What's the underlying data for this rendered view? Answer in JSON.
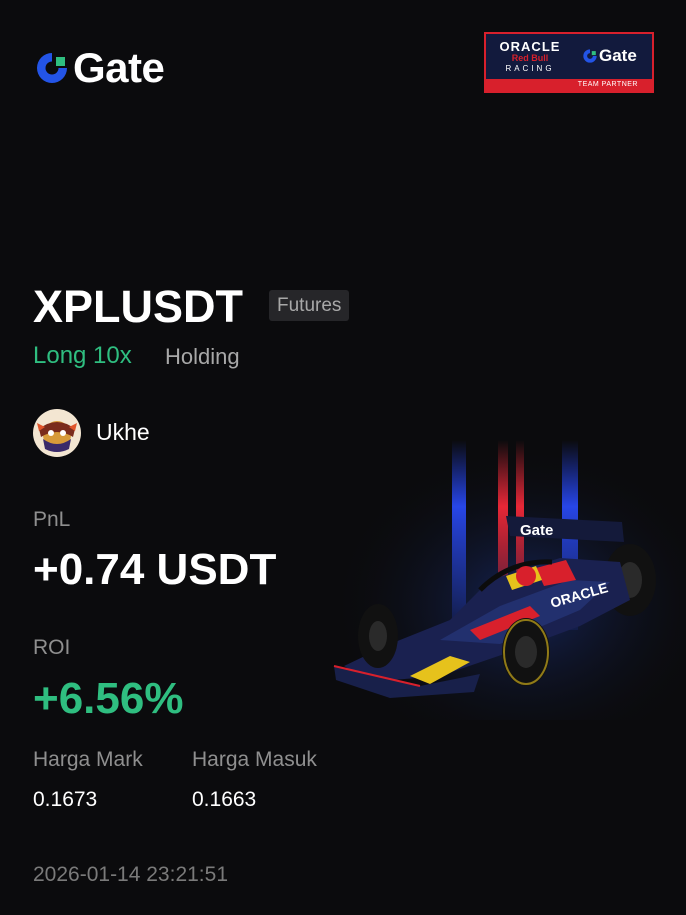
{
  "brand": {
    "name": "Gate",
    "icon": "gate-logo-icon"
  },
  "partner_badge": {
    "line1": "ORACLE",
    "line2": "Red Bull",
    "line3": "RACING",
    "brand": "Gate",
    "strip": "TEAM PARTNER"
  },
  "position": {
    "pair": "XPLUSDT",
    "market_tag": "Futures",
    "side": "Long 10x",
    "status": "Holding"
  },
  "user": {
    "name": "Ukhe",
    "avatar": "avatar-image"
  },
  "stats": {
    "pnl_label": "PnL",
    "pnl_value": "+0.74 USDT",
    "roi_label": "ROI",
    "roi_value": "+6.56%",
    "mark_label": "Harga Mark",
    "mark_value": "0.1673",
    "entry_label": "Harga Masuk",
    "entry_value": "0.1663"
  },
  "timestamp": "2026-01-14 23:21:51",
  "colors": {
    "background": "#0b0b0d",
    "accent_green": "#2fbe80",
    "brand_blue": "#2354e6",
    "partner_red": "#d8202c",
    "partner_navy": "#121a3d"
  },
  "illustration": {
    "car": "f1-racecar-image",
    "wing_text": "Gate"
  }
}
